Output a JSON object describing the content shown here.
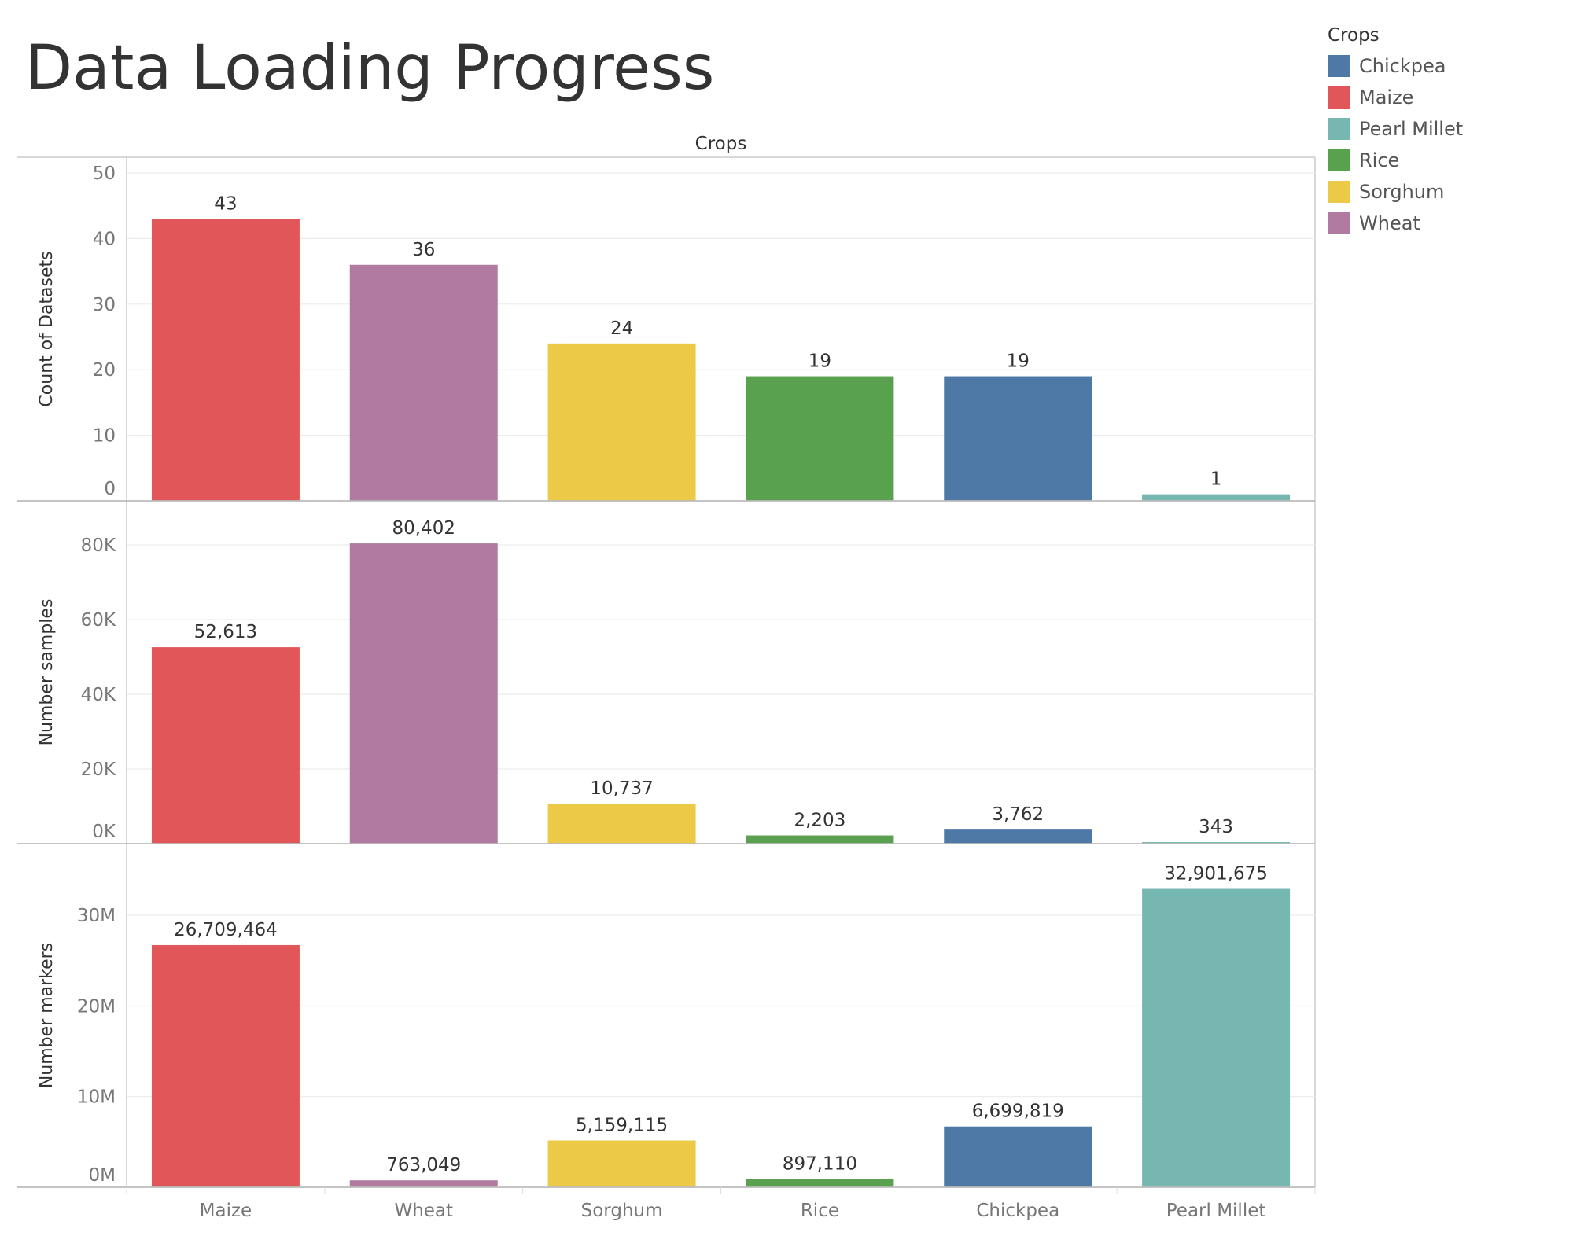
{
  "page_title": "Data Loading Progress",
  "legend": {
    "title": "Crops",
    "items": [
      {
        "label": "Chickpea",
        "color": "#4e79a7"
      },
      {
        "label": "Maize",
        "color": "#e15759"
      },
      {
        "label": "Pearl Millet",
        "color": "#76b7b2"
      },
      {
        "label": "Rice",
        "color": "#59a14f"
      },
      {
        "label": "Sorghum",
        "color": "#edc948"
      },
      {
        "label": "Wheat",
        "color": "#b07aa1"
      }
    ]
  },
  "chart_data": {
    "type": "bar",
    "column_header": "Crops",
    "categories": [
      "Maize",
      "Wheat",
      "Sorghum",
      "Rice",
      "Chickpea",
      "Pearl Millet"
    ],
    "category_colors": [
      "#e15759",
      "#b07aa1",
      "#edc948",
      "#59a14f",
      "#4e79a7",
      "#76b7b2"
    ],
    "panels": [
      {
        "ylabel": "Count of Datasets",
        "values": [
          43,
          36,
          24,
          19,
          19,
          1
        ],
        "value_labels": [
          "43",
          "36",
          "24",
          "19",
          "19",
          "1"
        ],
        "ylim": [
          0,
          50
        ],
        "ticks": [
          0,
          10,
          20,
          30,
          40,
          50
        ],
        "tick_labels": [
          "0",
          "10",
          "20",
          "30",
          "40",
          "50"
        ]
      },
      {
        "ylabel": "Number samples",
        "values": [
          52613,
          80402,
          10737,
          2203,
          3762,
          343
        ],
        "value_labels": [
          "52,613",
          "80,402",
          "10,737",
          "2,203",
          "3,762",
          "343"
        ],
        "ylim": [
          0,
          80000
        ],
        "ticks": [
          0,
          20000,
          40000,
          60000,
          80000
        ],
        "tick_labels": [
          "0K",
          "20K",
          "40K",
          "60K",
          "80K"
        ]
      },
      {
        "ylabel": "Number markers",
        "values": [
          26709464,
          763049,
          5159115,
          897110,
          6699819,
          32901675
        ],
        "value_labels": [
          "26,709,464",
          "763,049",
          "5,159,115",
          "897,110",
          "6,699,819",
          "32,901,675"
        ],
        "ylim": [
          0,
          30000000
        ],
        "ticks": [
          0,
          10000000,
          20000000,
          30000000
        ],
        "tick_labels": [
          "0M",
          "10M",
          "20M",
          "30M"
        ]
      }
    ],
    "grid": true
  }
}
